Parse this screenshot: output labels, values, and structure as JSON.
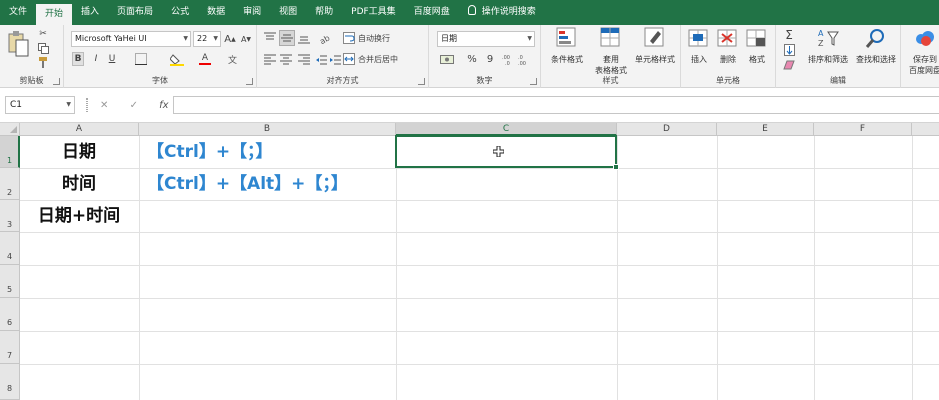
{
  "tabs": [
    {
      "label": "文件",
      "active": false
    },
    {
      "label": "开始",
      "active": true
    },
    {
      "label": "插入",
      "active": false
    },
    {
      "label": "页面布局",
      "active": false
    },
    {
      "label": "公式",
      "active": false
    },
    {
      "label": "数据",
      "active": false
    },
    {
      "label": "审阅",
      "active": false
    },
    {
      "label": "视图",
      "active": false
    },
    {
      "label": "帮助",
      "active": false
    },
    {
      "label": "PDF工具集",
      "active": false
    },
    {
      "label": "百度网盘",
      "active": false
    }
  ],
  "tellme": "操作说明搜索",
  "ribbon": {
    "clipboard": {
      "label": "剪贴板"
    },
    "font": {
      "label": "字体",
      "name": "Microsoft YaHei UI",
      "size": "22",
      "bold": "B",
      "italic": "I",
      "underline": "U",
      "grow": "A",
      "shrink": "A",
      "color_letter": "A"
    },
    "alignment": {
      "label": "对齐方式",
      "wrap": "自动换行",
      "merge": "合并后居中"
    },
    "number": {
      "label": "数字",
      "format": "日期",
      "percent": "%",
      "comma": "9"
    },
    "styles": {
      "label": "样式",
      "conditional": "条件格式",
      "table_line1": "套用",
      "table_line2": "表格格式",
      "cell_styles": "单元格样式"
    },
    "cells": {
      "label": "单元格",
      "insert": "插入",
      "delete": "删除",
      "format": "格式"
    },
    "editing": {
      "label": "编辑",
      "sort": "排序和筛选",
      "find": "查找和选择"
    },
    "save": {
      "line1": "保存到",
      "line2": "百度网盘"
    }
  },
  "formula_bar": {
    "name_box": "C1",
    "cancel": "✕",
    "enter": "✓",
    "fx": "fx",
    "content": ""
  },
  "columns": [
    "A",
    "B",
    "C",
    "D",
    "E",
    "F"
  ],
  "selected_column": "C",
  "rows": [
    "1",
    "2",
    "3",
    "4",
    "5",
    "6",
    "7",
    "8"
  ],
  "selected_row": "1",
  "cells": {
    "A1": "日期",
    "A2": "时间",
    "A3": "日期+时间",
    "B1": "【Ctrl】+【；】",
    "B2": "【Ctrl】+【Alt】+【；】"
  },
  "selected_cell": "C1",
  "colors": {
    "accent": "#217346",
    "blue_text": "#2e86d0"
  }
}
